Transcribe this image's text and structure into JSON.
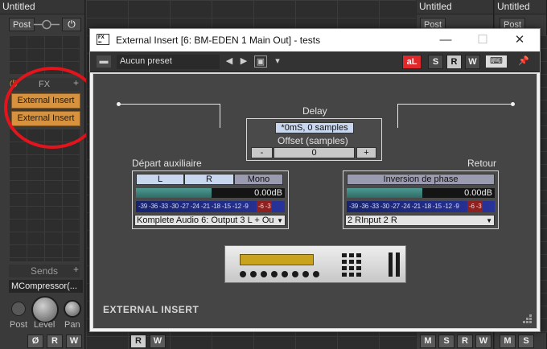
{
  "left_strip": {
    "title": "Untitled",
    "post_label": "Post",
    "fx_header": "FX",
    "fx_slots": [
      "External Insert",
      "External Insert"
    ],
    "sends_header": "Sends",
    "send_name": "MCompressor(...",
    "knob_labels": [
      "Post",
      "Level",
      "Pan"
    ],
    "bottom_buttons": [
      "Ø",
      "R",
      "W"
    ]
  },
  "right_strips": [
    {
      "title": "Untitled",
      "post_label": "Post",
      "bottom_buttons": [
        "M",
        "S",
        "R",
        "W"
      ]
    },
    {
      "title": "Untitled",
      "post_label": "Post",
      "bottom_buttons": [
        "M",
        "S"
      ]
    }
  ],
  "mid_bottom_buttons": [
    "R",
    "W"
  ],
  "window": {
    "title": "External Insert [6: BM-EDEN 1 Main Out] - tests",
    "preset": "Aucun preset",
    "toolbar_buttons": [
      "S",
      "R",
      "W"
    ],
    "delay": {
      "label": "Delay",
      "value": "*0mS, 0 samples",
      "offset_label": "Offset (samples)",
      "offset_value": "0",
      "minus": "-",
      "plus": "+"
    },
    "send": {
      "label": "Départ auxiliaire",
      "buttons": [
        "L",
        "R",
        "Mono"
      ],
      "level": "0.00dB",
      "level_fraction": 0.6,
      "scale": "-39 -36 -33 -30 -27 -24 -21 -18 -15 -12 -9",
      "scale_hot": "-6   -3",
      "output": "Komplete Audio 6: Output 3 L + Ou"
    },
    "return": {
      "label": "Retour",
      "phase_button": "Inversion de phase",
      "level": "0.00dB",
      "level_fraction": 0.6,
      "scale": "-39 -36 -33 -30 -27 -24 -21 -18 -15 -12 -9",
      "scale_hot": "-6   -3",
      "input": "2 RInput 2 R"
    },
    "footer": "EXTERNAL INSERT"
  },
  "colors": {
    "fx_slot": "#d8913c",
    "meter": "#4d9a92",
    "lcd": "#c9a21e",
    "highlight_ring": "#e3141b"
  }
}
